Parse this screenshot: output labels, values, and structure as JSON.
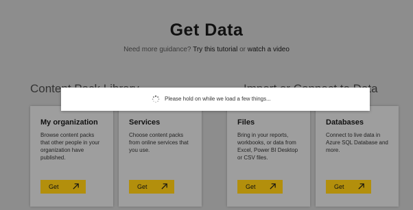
{
  "header": {
    "title": "Get Data",
    "guidance_prefix": "Need more guidance?",
    "tutorial_link": "Try this tutorial",
    "or_text": "or",
    "video_link": "watch a video"
  },
  "sections": {
    "left_heading": "Content Pack Library",
    "right_heading": "Import or Connect to Data"
  },
  "cards": [
    {
      "title": "My organization",
      "desc_lines": [
        "Browse content packs",
        "that other people in your",
        "organization have",
        "published."
      ],
      "button": "Get"
    },
    {
      "title": "Services",
      "desc_lines": [
        "Choose content packs",
        "from online services that",
        "you use."
      ],
      "button": "Get"
    },
    {
      "title": "Files",
      "desc_lines": [
        "Bring in your reports,",
        "workbooks, or data from",
        "Excel, Power BI Desktop",
        "or CSV files."
      ],
      "button": "Get"
    },
    {
      "title": "Databases",
      "desc_lines": [
        "Connect to live data in",
        "Azure SQL Database and",
        "more."
      ],
      "button": "Get"
    }
  ],
  "loading": {
    "message": "Please hold on while we load a few things...",
    "icon": "spinner-icon"
  },
  "colors": {
    "overlay_background": "#8d8d8d",
    "card_background": "#9e9e9e",
    "button_accent": "#b38f0c",
    "loading_background": "#ffffff"
  }
}
